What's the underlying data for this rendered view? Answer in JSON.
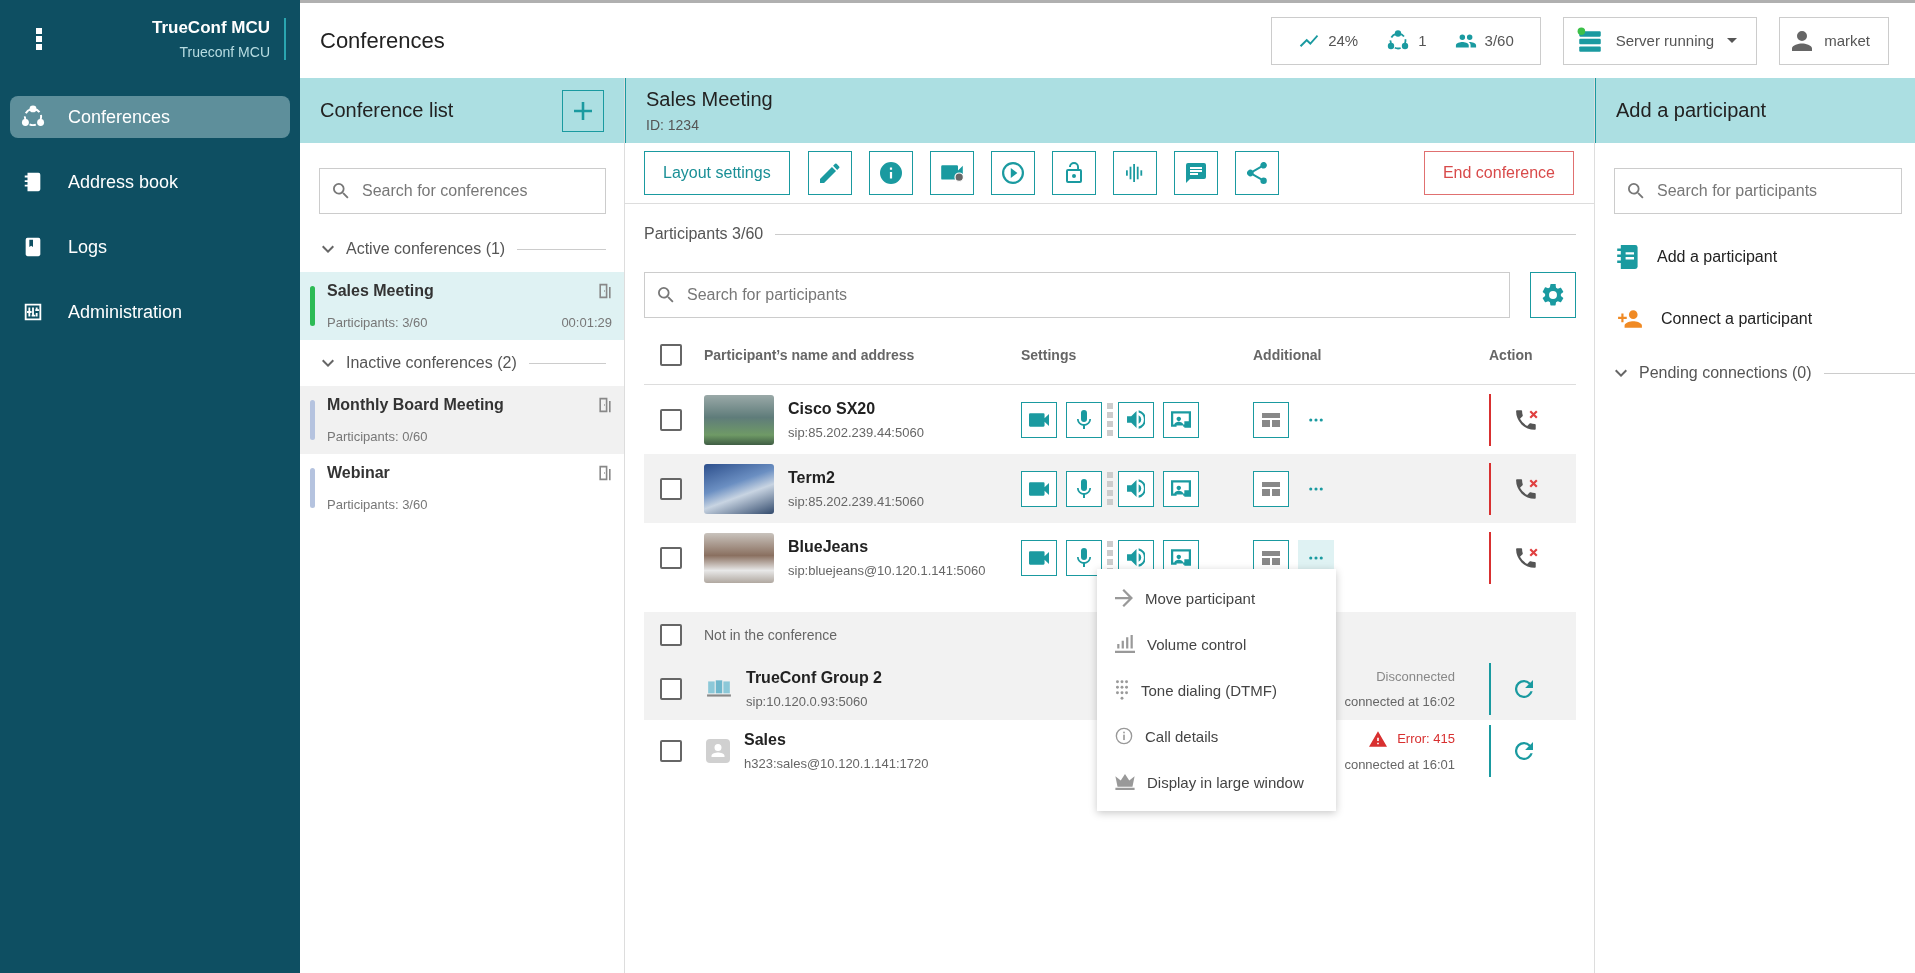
{
  "sidebar": {
    "brand": "TrueConf MCU",
    "server_name": "Trueconf MCU",
    "items": [
      {
        "label": "Conferences",
        "kind": "conferences",
        "selected": true
      },
      {
        "label": "Address book",
        "kind": "address-book",
        "selected": false
      },
      {
        "label": "Logs",
        "kind": "logs",
        "selected": false
      },
      {
        "label": "Administration",
        "kind": "administration",
        "selected": false
      }
    ]
  },
  "header": {
    "title": "Conferences",
    "stats": [
      {
        "kind": "load",
        "value": "24%"
      },
      {
        "kind": "conferences",
        "value": "1"
      },
      {
        "kind": "participants",
        "value": "3/60"
      }
    ],
    "server": {
      "label": "Server running",
      "running": true
    },
    "user": "market"
  },
  "conference_list": {
    "title": "Conference list",
    "search": {
      "placeholder": "Search for conferences"
    },
    "groups": [
      {
        "label": "Active conferences (1)",
        "items": [
          {
            "name": "Sales Meeting",
            "participants": "Participants: 3/60",
            "duration": "00:01:29",
            "live": true,
            "selected": true,
            "hovered": false
          }
        ]
      },
      {
        "label": "Inactive conferences (2)",
        "items": [
          {
            "name": "Monthly Board Meeting",
            "participants": "Participants: 0/60",
            "live": false,
            "selected": false,
            "hovered": true
          },
          {
            "name": "Webinar",
            "participants": "Participants: 3/60",
            "live": false,
            "selected": false,
            "hovered": false
          }
        ]
      }
    ]
  },
  "conference": {
    "title": "Sales Meeting",
    "id": "ID: 1234",
    "layout_button": "Layout settings",
    "end_button": "End conference",
    "participants_label": "Participants 3/60",
    "search": {
      "placeholder": "Search for participants"
    },
    "columns": [
      "Participant’s name and address",
      "Settings",
      "Additional",
      "Action"
    ],
    "participants": [
      {
        "name": "Cisco SX20",
        "address": "sip:85.202.239.44:5060",
        "checked": false,
        "menu_open": false
      },
      {
        "name": "Term2",
        "address": "sip:85.202.239.41:5060",
        "checked": false,
        "menu_open": false
      },
      {
        "name": "BlueJeans",
        "address": "sip:bluejeans@10.120.1.141:5060",
        "checked": false,
        "menu_open": true
      }
    ],
    "all_checked": false,
    "offline_label": "Not in the conference",
    "offline_all_checked": false,
    "offline": [
      {
        "name": "TrueConf Group 2",
        "address": "sip:10.120.0.93:5060",
        "checked": false,
        "avatar": {
          "kind": "room"
        },
        "status": {
          "kind": "disconnected",
          "text": "Disconnected"
        },
        "time": "connected at 16:02"
      },
      {
        "name": "Sales",
        "address": "h323:sales@10.120.1.141:1720",
        "checked": false,
        "avatar": {
          "kind": "person"
        },
        "status": {
          "kind": "error",
          "text": "Error: 415"
        },
        "time": "connected at 16:01"
      }
    ],
    "menu": [
      {
        "kind": "move",
        "label": "Move participant"
      },
      {
        "kind": "volume",
        "label": "Volume control"
      },
      {
        "kind": "dtmf",
        "label": "Tone dialing (DTMF)"
      },
      {
        "kind": "details",
        "label": "Call details"
      },
      {
        "kind": "large",
        "label": "Display in large window"
      }
    ]
  },
  "add_panel": {
    "title": "Add a participant",
    "search": {
      "placeholder": "Search for participants"
    },
    "actions": [
      {
        "kind": "address-book",
        "label": "Add a participant"
      },
      {
        "kind": "connect",
        "label": "Connect a participant"
      }
    ],
    "pending": "Pending connections (0)"
  }
}
